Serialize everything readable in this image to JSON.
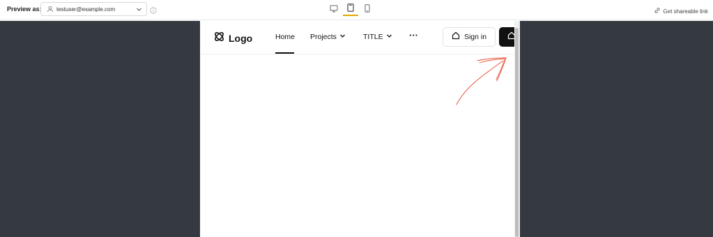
{
  "toolbar": {
    "preview_label": "Preview as:",
    "user_value": "testuser@example.com",
    "share_label": "Get shareable link",
    "active_device": "tablet",
    "accent_color": "#e0a800"
  },
  "site": {
    "logo_text": "Logo",
    "nav": {
      "home": "Home",
      "projects": "Projects",
      "title": "TITLE",
      "more": "···"
    },
    "signin_label": "Sign in"
  },
  "colors": {
    "stage": "#343a40",
    "annotation": "#e8503a"
  }
}
